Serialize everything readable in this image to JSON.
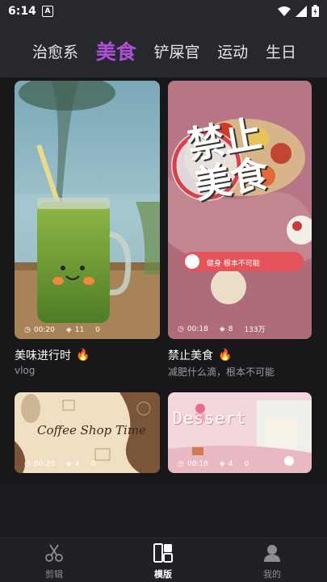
{
  "status": {
    "time": "6:14",
    "notification": "A"
  },
  "tabs": [
    {
      "label": "治愈系",
      "active": false
    },
    {
      "label": "美食",
      "active": true
    },
    {
      "label": "铲屎官",
      "active": false
    },
    {
      "label": "运动",
      "active": false
    },
    {
      "label": "生日",
      "active": false
    }
  ],
  "cards": [
    {
      "duration": "00:20",
      "layers": "11",
      "uses": "0",
      "title": "美味进行时",
      "subtitle": "vlog"
    },
    {
      "duration": "00:18",
      "layers": "8",
      "uses": "133万",
      "title": "禁止美食",
      "subtitle": "减肥什么滴，根本不可能",
      "overlay_big": "禁止美食",
      "overlay_small": "健身 根本不可能"
    },
    {
      "duration": "00:20",
      "layers": "4",
      "uses": "0",
      "overlay_text": "Coffee Shop Time"
    },
    {
      "duration": "00:16",
      "layers": "4",
      "uses": "0",
      "overlay_text": "Dessert"
    }
  ],
  "nav": [
    {
      "label": "剪辑",
      "icon": "scissors-icon",
      "active": false
    },
    {
      "label": "模版",
      "icon": "template-grid-icon",
      "active": true
    },
    {
      "label": "我的",
      "icon": "profile-icon",
      "active": false
    }
  ],
  "colors": {
    "accent": "#b04fd6",
    "background": "#1b1c20",
    "bar": "#26282e"
  }
}
